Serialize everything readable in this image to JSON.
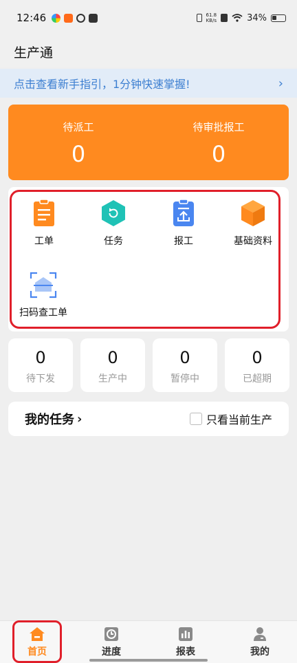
{
  "status_bar": {
    "time": "12:46",
    "net_speed_value": "61.8",
    "net_speed_unit": "KB/s",
    "battery": "34%"
  },
  "header": {
    "title": "生产通"
  },
  "guide_banner": {
    "text": "点击查看新手指引，1分钟快速掌握!",
    "chevron": "›"
  },
  "stats": [
    {
      "label": "待派工",
      "value": "0"
    },
    {
      "label": "待审批报工",
      "value": "0"
    }
  ],
  "menu": {
    "items": [
      {
        "label": "工单",
        "icon": "work-order-icon",
        "color": "#ff8a1f"
      },
      {
        "label": "任务",
        "icon": "task-icon",
        "color": "#1fc2b6"
      },
      {
        "label": "报工",
        "icon": "report-work-icon",
        "color": "#4a86f0"
      },
      {
        "label": "基础资料",
        "icon": "basic-data-icon",
        "color": "#ff8a1f"
      },
      {
        "label": "扫码查工单",
        "icon": "scan-icon",
        "color": "#4a86f0"
      }
    ]
  },
  "counters": [
    {
      "value": "0",
      "label": "待下发"
    },
    {
      "value": "0",
      "label": "生产中"
    },
    {
      "value": "0",
      "label": "暂停中"
    },
    {
      "value": "0",
      "label": "已超期"
    }
  ],
  "tasks": {
    "title": "我的任务",
    "chevron": "›",
    "filter_label": "只看当前生产",
    "filter_checked": false
  },
  "bottom_nav": {
    "items": [
      {
        "label": "首页",
        "icon": "home-icon",
        "active": true
      },
      {
        "label": "进度",
        "icon": "progress-icon",
        "active": false
      },
      {
        "label": "报表",
        "icon": "report-icon",
        "active": false
      },
      {
        "label": "我的",
        "icon": "profile-icon",
        "active": false
      }
    ]
  },
  "colors": {
    "accent": "#ff8a1f",
    "highlight": "#e01f2a",
    "link": "#3d7fd1"
  }
}
